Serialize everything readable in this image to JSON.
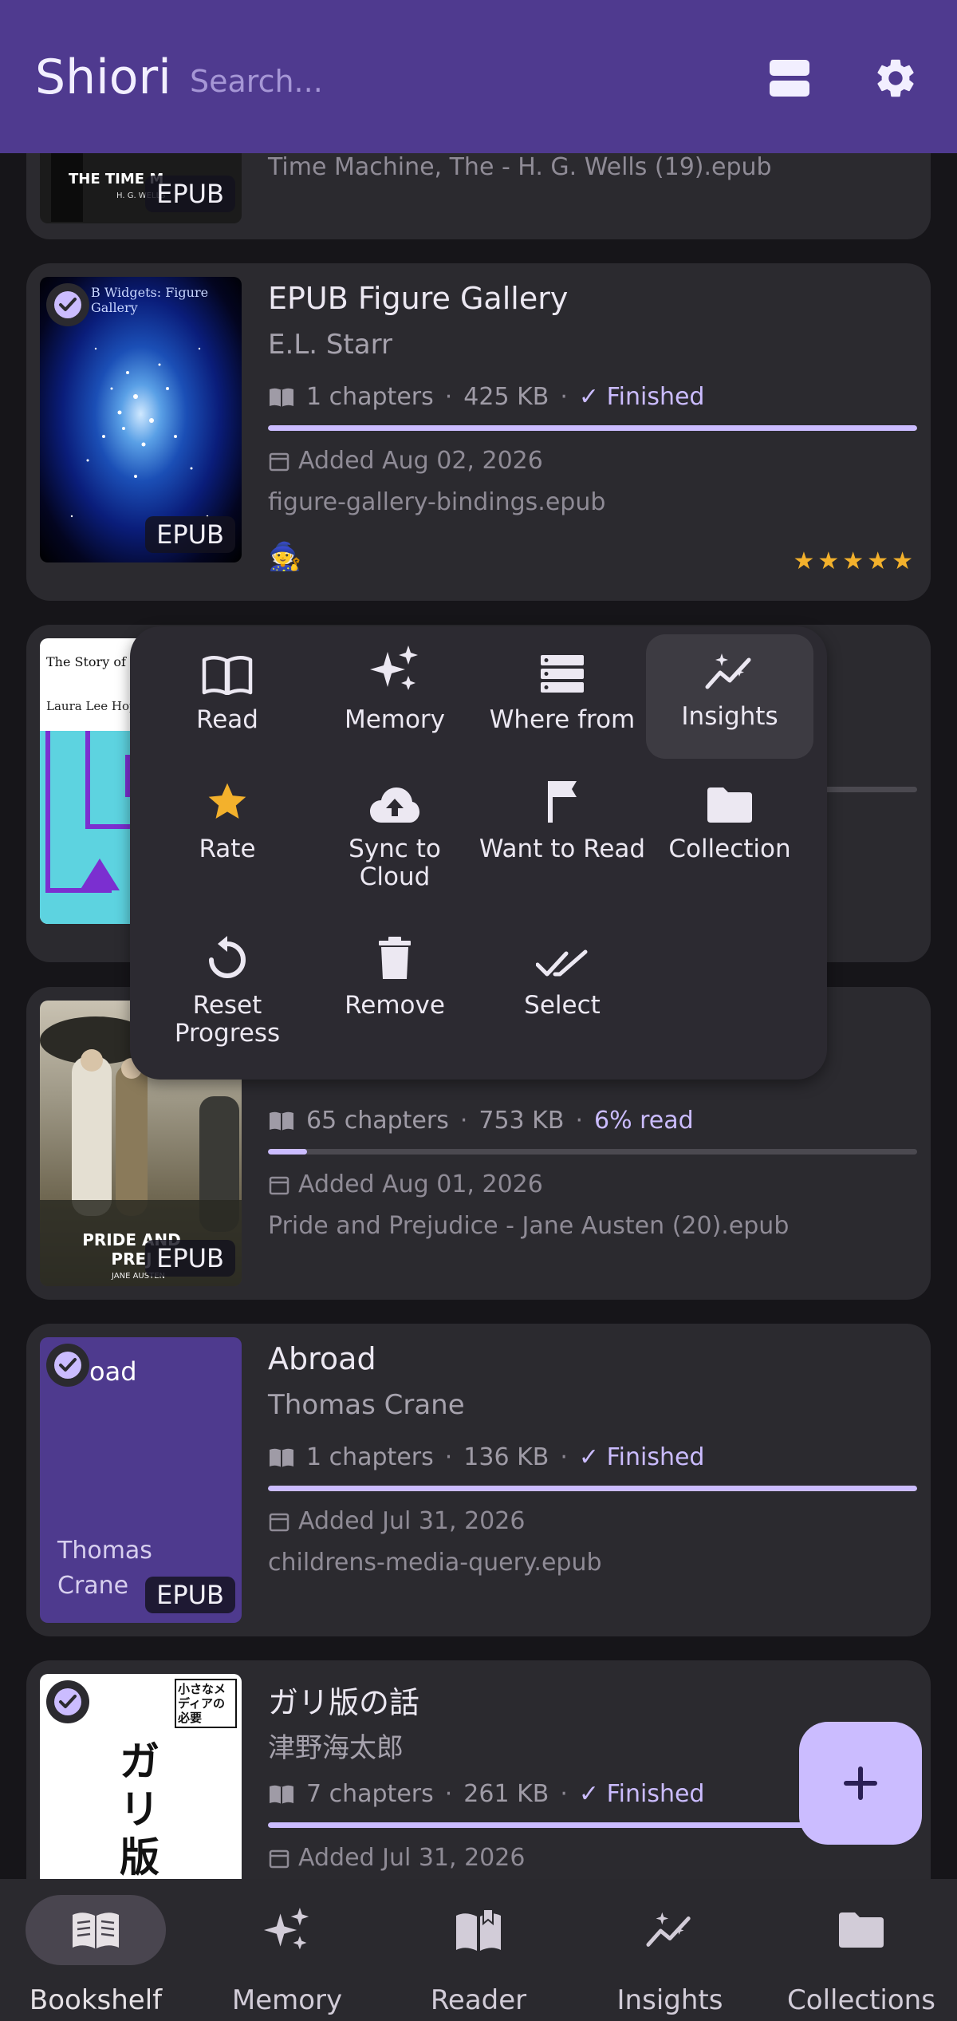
{
  "app": {
    "title": "Shiori",
    "search_placeholder": "Search..."
  },
  "topbar_icons": [
    "view-toggle-icon",
    "gear-icon"
  ],
  "books": [
    {
      "title": "",
      "cover_text": "THE TIME M",
      "cover_sub": "H. G. WELLS",
      "format": "EPUB",
      "file": "Time Machine, The - H. G. Wells (19).epub"
    },
    {
      "title": "EPUB Figure Gallery",
      "cover_text": "B Widgets: Figure Gallery",
      "author": "E.L. Starr",
      "chapters": "1 chapters",
      "size": "425 KB",
      "status": "✓ Finished",
      "progress": 1.0,
      "added": "Added Aug 02, 2026",
      "file": "figure-gallery-bindings.epub",
      "format": "EPUB",
      "selected": true,
      "badge": "🧙",
      "rating": 5,
      "stars": "★★★★★"
    },
    {
      "title": "",
      "cover_text": "The Story of a C",
      "cover_author": "Laura Lee Hope",
      "progress": 0.0
    },
    {
      "title": "",
      "cover_text": "PRIDE AND PREJ",
      "cover_sub": "JANE AUSTEN",
      "chapters": "65 chapters",
      "size": "753 KB",
      "status": "6% read",
      "progress": 0.06,
      "added": "Added Aug 01, 2026",
      "file": "Pride and Prejudice - Jane Austen (20).epub",
      "format": "EPUB"
    },
    {
      "title": "Abroad",
      "cover_text": "oad",
      "cover_author": "Thomas Crane",
      "author": "Thomas Crane",
      "chapters": "1 chapters",
      "size": "136 KB",
      "status": "✓ Finished",
      "progress": 1.0,
      "added": "Added Jul 31, 2026",
      "file": "childrens-media-query.epub",
      "format": "EPUB",
      "selected": true
    },
    {
      "title": "ガリ版の話",
      "cover_text": "ガリ版の話",
      "cover_corner": "小さなメディアの必要",
      "author": "津野海太郎",
      "chapters": "7 chapters",
      "size": "261 KB",
      "status": "✓ Finished",
      "progress": 1.0,
      "added": "Added Jul 31, 2026",
      "selected": true
    }
  ],
  "popup_menu": [
    {
      "label": "Read",
      "icon": "book-open-icon"
    },
    {
      "label": "Memory",
      "icon": "sparkles-icon"
    },
    {
      "label": "Where from",
      "icon": "server-icon"
    },
    {
      "label": "Insights",
      "icon": "insights-icon",
      "active": true
    },
    {
      "label": "Rate",
      "icon": "star-icon"
    },
    {
      "label": "Sync to Cloud",
      "icon": "cloud-upload-icon"
    },
    {
      "label": "Want to Read",
      "icon": "flag-icon"
    },
    {
      "label": "Collection",
      "icon": "folder-icon"
    },
    {
      "label": "Reset Progress",
      "icon": "reset-icon"
    },
    {
      "label": "Remove",
      "icon": "trash-icon"
    },
    {
      "label": "Select",
      "icon": "double-check-icon"
    }
  ],
  "fab": {
    "icon": "plus-icon",
    "label": "+"
  },
  "bottom_nav": [
    {
      "label": "Bookshelf",
      "icon": "book-open-icon",
      "active": true
    },
    {
      "label": "Memory",
      "icon": "sparkles-icon"
    },
    {
      "label": "Reader",
      "icon": "book-reader-icon"
    },
    {
      "label": "Insights",
      "icon": "insights-icon"
    },
    {
      "label": "Collections",
      "icon": "folder-icon"
    }
  ],
  "colors": {
    "appbar": "#4f3a8f",
    "background": "#161519",
    "card": "#2b2a2f",
    "accent": "#cbbcff",
    "star": "#f3b12c"
  }
}
